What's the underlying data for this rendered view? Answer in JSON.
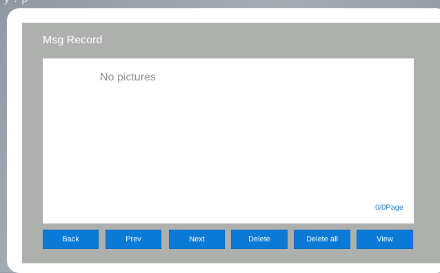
{
  "window": {
    "top_strip_text": "y     .     p"
  },
  "panel": {
    "title": "Msg Record"
  },
  "content": {
    "empty_message": "No pictures",
    "page_indicator": "0/0Page"
  },
  "buttons": {
    "back": "Back",
    "prev": "Prev",
    "next": "Next",
    "delete": "Delete",
    "delete_all": "Delete all",
    "view": "View"
  },
  "colors": {
    "accent": "#0b79d6",
    "panel_bg": "#aeb0ae",
    "page_indicator": "#1a7fcf"
  }
}
